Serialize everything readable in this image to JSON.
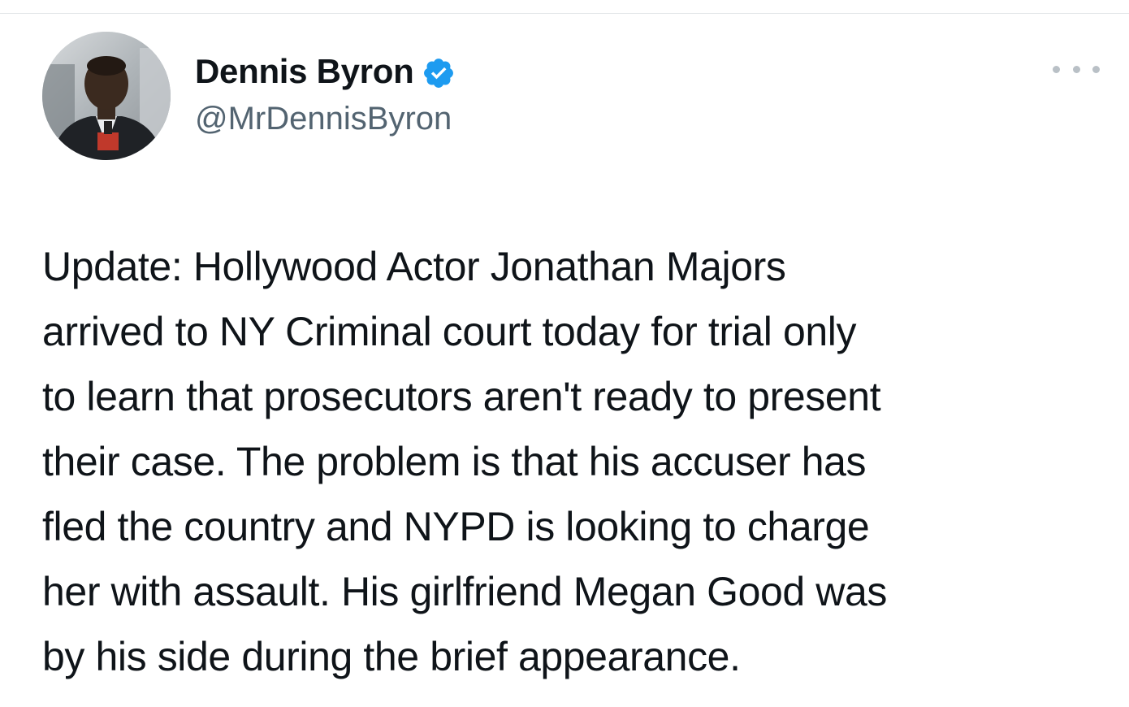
{
  "author": {
    "display_name": "Dennis Byron",
    "handle": "@MrDennisByron",
    "verified": true,
    "avatar_icon": "profile-photo",
    "verified_icon": "verified-badge-icon",
    "verified_color": "#1d9bf0"
  },
  "menu": {
    "icon": "more-options-icon"
  },
  "tweet": {
    "text": "Update: Hollywood Actor Jonathan Majors\narrived to NY Criminal court today for trial only\nto learn that prosecutors aren't ready to present\ntheir case. The problem is that his accuser has\nfled the country and NYPD is looking to charge\nher with assault. His girlfriend Megan Good was\nby his side during the brief appearance."
  }
}
